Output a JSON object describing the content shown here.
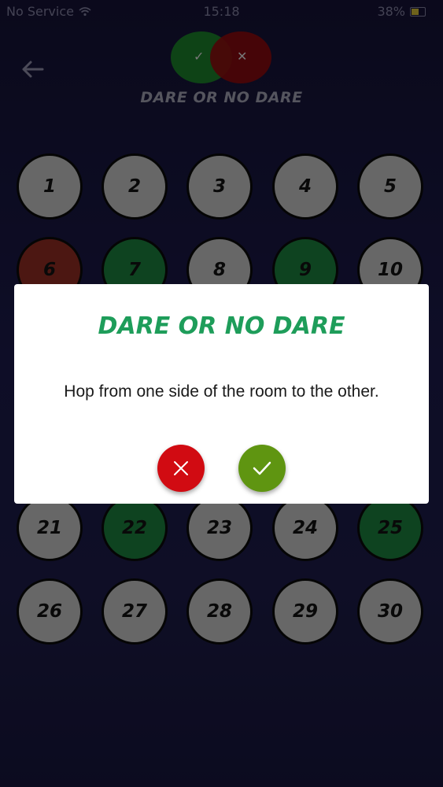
{
  "status_bar": {
    "carrier": "No Service",
    "time": "15:18",
    "battery": "38%"
  },
  "header": {
    "title": "DARE OR NO DARE"
  },
  "grid": {
    "cells": [
      {
        "label": "1",
        "state": "neutral"
      },
      {
        "label": "2",
        "state": "neutral"
      },
      {
        "label": "3",
        "state": "neutral"
      },
      {
        "label": "4",
        "state": "neutral"
      },
      {
        "label": "5",
        "state": "neutral"
      },
      {
        "label": "6",
        "state": "red"
      },
      {
        "label": "7",
        "state": "green"
      },
      {
        "label": "8",
        "state": "neutral"
      },
      {
        "label": "9",
        "state": "green"
      },
      {
        "label": "10",
        "state": "neutral"
      },
      {
        "label": "21",
        "state": "neutral"
      },
      {
        "label": "22",
        "state": "green"
      },
      {
        "label": "23",
        "state": "neutral"
      },
      {
        "label": "24",
        "state": "neutral"
      },
      {
        "label": "25",
        "state": "green"
      },
      {
        "label": "26",
        "state": "neutral"
      },
      {
        "label": "27",
        "state": "neutral"
      },
      {
        "label": "28",
        "state": "neutral"
      },
      {
        "label": "29",
        "state": "neutral"
      },
      {
        "label": "30",
        "state": "neutral"
      }
    ]
  },
  "modal": {
    "title": "DARE OR NO DARE",
    "text": "Hop from one side of the room to the other."
  },
  "colors": {
    "accent_green": "#1e9d5a",
    "no_button": "#d10b12",
    "yes_button": "#5f9511"
  }
}
